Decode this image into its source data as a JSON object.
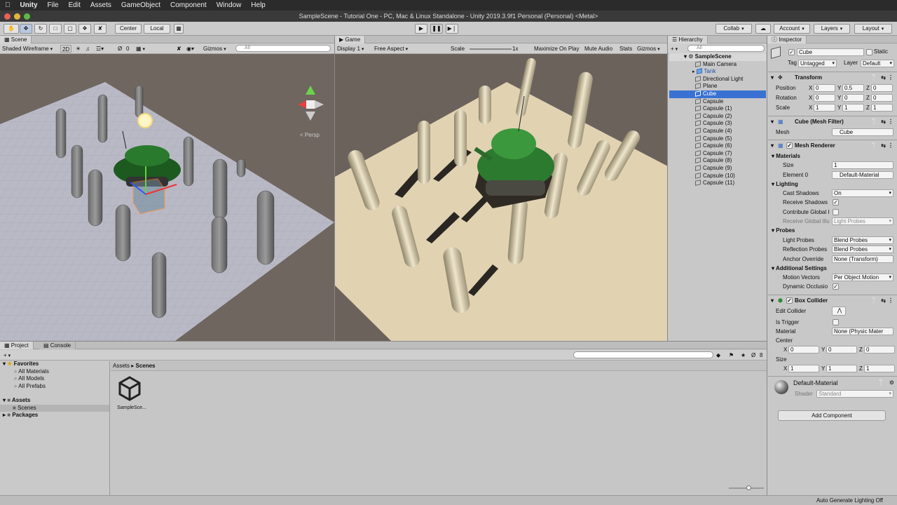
{
  "menubar": {
    "apple": "",
    "items": [
      "Unity",
      "File",
      "Edit",
      "Assets",
      "GameObject",
      "Component",
      "Window",
      "Help"
    ]
  },
  "window_title": "SampleScene - Tutorial One - PC, Mac & Linux Standalone - Unity 2019.3.9f1 Personal (Personal) <Metal>",
  "toolbar": {
    "center": "Center",
    "local": "Local",
    "collab": "Collab",
    "account": "Account",
    "layers": "Layers",
    "layout": "Layout"
  },
  "scene": {
    "tab": "Scene",
    "shading": "Shaded Wireframe",
    "mode2d": "2D",
    "hidden_count": "0",
    "gizmos": "Gizmos",
    "search_placeholder": "All",
    "persp": "< Persp"
  },
  "game": {
    "tab": "Game",
    "display": "Display 1",
    "aspect": "Free Aspect",
    "scale_label": "Scale",
    "scale_value": "1x",
    "maximize": "Maximize On Play",
    "mute": "Mute Audio",
    "stats": "Stats",
    "gizmos": "Gizmos"
  },
  "hierarchy": {
    "tab": "Hierarchy",
    "add": "+",
    "search_placeholder": "All",
    "scene": "SampleScene",
    "items": [
      {
        "label": "Main Camera",
        "selected": false,
        "prefab": false
      },
      {
        "label": "Tank",
        "selected": false,
        "prefab": true
      },
      {
        "label": "Directional Light",
        "selected": false,
        "prefab": false
      },
      {
        "label": "Plane",
        "selected": false,
        "prefab": false
      },
      {
        "label": "Cube",
        "selected": true,
        "prefab": false
      },
      {
        "label": "Capsule",
        "selected": false,
        "prefab": false
      },
      {
        "label": "Capsule (1)",
        "selected": false,
        "prefab": false
      },
      {
        "label": "Capsule (2)",
        "selected": false,
        "prefab": false
      },
      {
        "label": "Capsule (3)",
        "selected": false,
        "prefab": false
      },
      {
        "label": "Capsule (4)",
        "selected": false,
        "prefab": false
      },
      {
        "label": "Capsule (5)",
        "selected": false,
        "prefab": false
      },
      {
        "label": "Capsule (6)",
        "selected": false,
        "prefab": false
      },
      {
        "label": "Capsule (7)",
        "selected": false,
        "prefab": false
      },
      {
        "label": "Capsule (8)",
        "selected": false,
        "prefab": false
      },
      {
        "label": "Capsule (9)",
        "selected": false,
        "prefab": false
      },
      {
        "label": "Capsule (10)",
        "selected": false,
        "prefab": false
      },
      {
        "label": "Capsule (11)",
        "selected": false,
        "prefab": false
      }
    ]
  },
  "inspector": {
    "tab": "Inspector",
    "object_name": "Cube",
    "static": "Static",
    "tag_label": "Tag",
    "tag": "Untagged",
    "layer_label": "Layer",
    "layer": "Default",
    "transform": {
      "title": "Transform",
      "position_label": "Position",
      "position": [
        "0",
        "0.5",
        "0"
      ],
      "rotation_label": "Rotation",
      "rotation": [
        "0",
        "0",
        "0"
      ],
      "scale_label": "Scale",
      "scale": [
        "1",
        "1",
        "1"
      ]
    },
    "mesh_filter": {
      "title": "Cube (Mesh Filter)",
      "mesh_label": "Mesh",
      "mesh": "Cube"
    },
    "mesh_renderer": {
      "title": "Mesh Renderer",
      "materials": "Materials",
      "size_label": "Size",
      "size": "1",
      "element0_label": "Element 0",
      "element0": "Default-Material",
      "lighting": "Lighting",
      "cast_shadows_label": "Cast Shadows",
      "cast_shadows": "On",
      "receive_shadows_label": "Receive Shadows",
      "contribute_gi_label": "Contribute Global I",
      "receive_gi_label": "Receive Global Illu",
      "receive_gi": "Light Probes",
      "probes": "Probes",
      "light_probes_label": "Light Probes",
      "light_probes": "Blend Probes",
      "reflection_probes_label": "Reflection Probes",
      "reflection_probes": "Blend Probes",
      "anchor_override_label": "Anchor Override",
      "anchor_override": "None (Transform)",
      "additional": "Additional Settings",
      "motion_vectors_label": "Motion Vectors",
      "motion_vectors": "Per Object Motion",
      "dynamic_occlusion_label": "Dynamic Occlusio"
    },
    "box_collider": {
      "title": "Box Collider",
      "edit_collider_label": "Edit Collider",
      "is_trigger_label": "Is Trigger",
      "material_label": "Material",
      "material": "None (Physic Mater",
      "center_label": "Center",
      "center": [
        "0",
        "0",
        "0"
      ],
      "size_label": "Size",
      "size": [
        "1",
        "1",
        "1"
      ]
    },
    "material": {
      "name": "Default-Material",
      "shader_label": "Shader",
      "shader": "Standard"
    },
    "add_component": "Add Component"
  },
  "project": {
    "tab_project": "Project",
    "tab_console": "Console",
    "add": "+",
    "favorites": "Favorites",
    "fav_items": [
      "All Materials",
      "All Models",
      "All Prefabs"
    ],
    "assets": "Assets",
    "scenes": "Scenes",
    "packages": "Packages",
    "breadcrumb": [
      "Assets",
      "Scenes"
    ],
    "asset_name": "SampleSce...",
    "hidden_count": "8"
  },
  "status": {
    "text": "Auto Generate Lighting Off"
  },
  "xyz": [
    "X",
    "Y",
    "Z"
  ]
}
